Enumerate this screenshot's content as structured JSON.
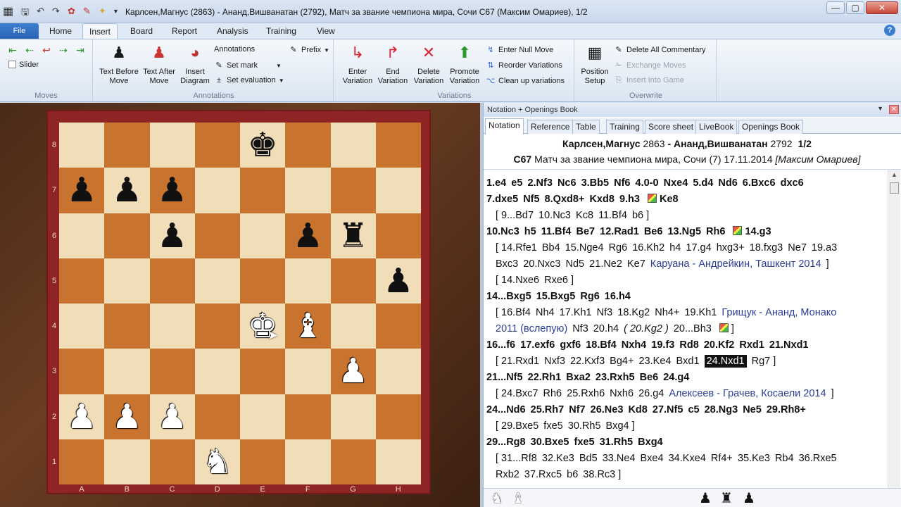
{
  "titlebar": {
    "title": "Карлсен,Магнус (2863) - Ананд,Вишванатан (2792), Матч за звание чемпиона мира, Сочи  C67  (Максим Омариев), 1/2",
    "minimize": "—",
    "maximize": "▢",
    "close": "✕"
  },
  "menu": {
    "file": "File",
    "tabs": [
      "Home",
      "Insert",
      "Board",
      "Report",
      "Analysis",
      "Training",
      "View"
    ],
    "active": "Insert"
  },
  "ribbon": {
    "moves": {
      "slider": "Slider",
      "label": "Moves"
    },
    "annotations": {
      "text_before": "Text Before Move",
      "text_after": "Text After Move",
      "insert_diagram": "Insert Diagram",
      "annotations": "Annotations",
      "set_mark": "Set mark",
      "set_evaluation": "Set evaluation",
      "prefix": "Prefix",
      "label": "Annotations"
    },
    "variations": {
      "enter": "Enter Variation",
      "end": "End Variation",
      "delete": "Delete Variation",
      "promote": "Promote Variation",
      "null_move": "Enter Null Move",
      "reorder": "Reorder Variations",
      "clean_up": "Clean up variations",
      "label": "Variations"
    },
    "overwrite": {
      "position_setup": "Position Setup",
      "delete_commentary": "Delete All Commentary",
      "exchange_moves": "Exchange Moves",
      "insert_into_game": "Insert Into Game",
      "label": "Overwrite"
    }
  },
  "board": {
    "ranks": [
      "8",
      "7",
      "6",
      "5",
      "4",
      "3",
      "2",
      "1"
    ],
    "files": [
      "A",
      "B",
      "C",
      "D",
      "E",
      "F",
      "G",
      "H"
    ],
    "position": [
      [
        "",
        "",
        "",
        "",
        "bk",
        "",
        "",
        ""
      ],
      [
        "bp",
        "bp",
        "bp",
        "",
        "",
        "",
        "",
        ""
      ],
      [
        "",
        "",
        "bp",
        "",
        "",
        "bp",
        "br",
        ""
      ],
      [
        "",
        "",
        "",
        "",
        "",
        "",
        "",
        "bp"
      ],
      [
        "",
        "",
        "",
        "",
        "wk",
        "wb",
        "",
        ""
      ],
      [
        "",
        "",
        "",
        "",
        "",
        "",
        "wp",
        ""
      ],
      [
        "wp",
        "wp",
        "wp",
        "",
        "",
        "",
        "",
        ""
      ],
      [
        "",
        "",
        "",
        "wn",
        "",
        "",
        "",
        ""
      ]
    ]
  },
  "panel": {
    "title": "Notation + Openings Book",
    "tabs": [
      "Notation",
      "Reference",
      "Table",
      "Training",
      "Score sheet",
      "LiveBook",
      "Openings Book"
    ],
    "active_tab": "Notation",
    "white": "Карлсен,Магнус",
    "white_elo": "2863",
    "black": "Ананд,Вишванатан",
    "black_elo": "2792",
    "result": "1/2",
    "eco": "C67",
    "event": "Матч за звание чемпиона мира, Сочи (7) 17.11.2014",
    "annotator": "[Максим Омариев]"
  },
  "notation": [
    {
      "type": "main",
      "parts": [
        {
          "t": "1.e4"
        },
        {
          "t": "e5"
        },
        {
          "t": "2.Nf3"
        },
        {
          "t": "Nc6"
        },
        {
          "t": "3.Bb5"
        },
        {
          "t": "Nf6"
        },
        {
          "t": "4.0-0"
        },
        {
          "t": "Nxe4"
        },
        {
          "t": "5.d4"
        },
        {
          "t": "Nd6"
        },
        {
          "t": "6.Bxc6"
        },
        {
          "t": "dxc6"
        }
      ]
    },
    {
      "type": "main",
      "parts": [
        {
          "t": "7.dxe5"
        },
        {
          "t": "Nf5"
        },
        {
          "t": "8.Qxd8+"
        },
        {
          "t": "Kxd8"
        },
        {
          "t": "9.h3"
        },
        {
          "flag": true
        },
        {
          "t": "Ke8"
        }
      ]
    },
    {
      "type": "var",
      "parts": [
        {
          "t": "[ 9...Bd7"
        },
        {
          "t": "10.Nc3"
        },
        {
          "t": "Kc8"
        },
        {
          "t": "11.Bf4"
        },
        {
          "t": "b6 ]"
        }
      ]
    },
    {
      "type": "main",
      "parts": [
        {
          "t": "10.Nc3"
        },
        {
          "t": "h5"
        },
        {
          "t": "11.Bf4"
        },
        {
          "t": "Be7"
        },
        {
          "t": "12.Rad1"
        },
        {
          "t": "Be6"
        },
        {
          "t": "13.Ng5"
        },
        {
          "t": "Rh6"
        },
        {
          "flag": true
        },
        {
          "t": "14.g3"
        }
      ]
    },
    {
      "type": "var",
      "parts": [
        {
          "t": "[ 14.Rfe1"
        },
        {
          "t": "Bb4"
        },
        {
          "t": "15.Nge4"
        },
        {
          "t": "Rg6"
        },
        {
          "t": "16.Kh2"
        },
        {
          "t": "h4"
        },
        {
          "t": "17.g4"
        },
        {
          "t": "hxg3+"
        },
        {
          "t": "18.fxg3"
        },
        {
          "t": "Ne7"
        },
        {
          "t": "19.a3"
        }
      ]
    },
    {
      "type": "var",
      "parts": [
        {
          "t": "Bxc3"
        },
        {
          "t": "20.Nxc3"
        },
        {
          "t": "Nd5"
        },
        {
          "t": "21.Ne2"
        },
        {
          "t": "Ke7"
        },
        {
          "t": "Каруана - Андрейкин, Ташкент 2014",
          "ref": true
        },
        {
          "t": "]"
        }
      ]
    },
    {
      "type": "var",
      "parts": [
        {
          "t": "[ 14.Nxe6"
        },
        {
          "t": "Rxe6 ]"
        }
      ]
    },
    {
      "type": "main",
      "parts": [
        {
          "t": "14...Bxg5"
        },
        {
          "t": "15.Bxg5"
        },
        {
          "t": "Rg6"
        },
        {
          "t": "16.h4"
        }
      ]
    },
    {
      "type": "var",
      "parts": [
        {
          "t": "[ 16.Bf4"
        },
        {
          "t": "Nh4"
        },
        {
          "t": "17.Kh1"
        },
        {
          "t": "Nf3"
        },
        {
          "t": "18.Kg2"
        },
        {
          "t": "Nh4+"
        },
        {
          "t": "19.Kh1"
        },
        {
          "t": "Грищук - Ананд, Монако",
          "ref": true
        }
      ]
    },
    {
      "type": "var",
      "parts": [
        {
          "t": "2011 (вслепую)",
          "ref": true
        },
        {
          "t": "Nf3"
        },
        {
          "t": "20.h4"
        },
        {
          "t": "( 20.Kg2 )",
          "ital": true
        },
        {
          "t": "20...Bh3"
        },
        {
          "flag": true
        },
        {
          "t": "]"
        }
      ]
    },
    {
      "type": "main",
      "parts": [
        {
          "t": "16...f6"
        },
        {
          "t": "17.exf6"
        },
        {
          "t": "gxf6"
        },
        {
          "t": "18.Bf4"
        },
        {
          "t": "Nxh4"
        },
        {
          "t": "19.f3"
        },
        {
          "t": "Rd8"
        },
        {
          "t": "20.Kf2"
        },
        {
          "t": "Rxd1"
        },
        {
          "t": "21.Nxd1"
        }
      ]
    },
    {
      "type": "var",
      "parts": [
        {
          "t": "[ 21.Rxd1"
        },
        {
          "t": "Nxf3"
        },
        {
          "t": "22.Kxf3"
        },
        {
          "t": "Bg4+"
        },
        {
          "t": "23.Ke4"
        },
        {
          "t": "Bxd1"
        },
        {
          "t": "24.Nxd1",
          "cur": true
        },
        {
          "t": "Rg7 ]"
        }
      ]
    },
    {
      "type": "main",
      "parts": [
        {
          "t": "21...Nf5"
        },
        {
          "t": "22.Rh1"
        },
        {
          "t": "Bxa2"
        },
        {
          "t": "23.Rxh5"
        },
        {
          "t": "Be6"
        },
        {
          "t": "24.g4"
        }
      ]
    },
    {
      "type": "var",
      "parts": [
        {
          "t": "[ 24.Bxc7"
        },
        {
          "t": "Rh6"
        },
        {
          "t": "25.Rxh6"
        },
        {
          "t": "Nxh6"
        },
        {
          "t": "26.g4"
        },
        {
          "t": "Алексеев - Грачев, Косаели 2014",
          "ref": true
        },
        {
          "t": "]"
        }
      ]
    },
    {
      "type": "main",
      "parts": [
        {
          "t": "24...Nd6"
        },
        {
          "t": "25.Rh7"
        },
        {
          "t": "Nf7"
        },
        {
          "t": "26.Ne3"
        },
        {
          "t": "Kd8"
        },
        {
          "t": "27.Nf5"
        },
        {
          "t": "c5"
        },
        {
          "t": "28.Ng3"
        },
        {
          "t": "Ne5"
        },
        {
          "t": "29.Rh8+"
        }
      ]
    },
    {
      "type": "var",
      "parts": [
        {
          "t": "[ 29.Bxe5"
        },
        {
          "t": "fxe5"
        },
        {
          "t": "30.Rh5"
        },
        {
          "t": "Bxg4 ]"
        }
      ]
    },
    {
      "type": "main",
      "parts": [
        {
          "t": "29...Rg8"
        },
        {
          "t": "30.Bxe5"
        },
        {
          "t": "fxe5"
        },
        {
          "t": "31.Rh5"
        },
        {
          "t": "Bxg4"
        }
      ]
    },
    {
      "type": "var",
      "parts": [
        {
          "t": "[ 31...Rf8"
        },
        {
          "t": "32.Ke3"
        },
        {
          "t": "Bd5"
        },
        {
          "t": "33.Ne4"
        },
        {
          "t": "Bxe4"
        },
        {
          "t": "34.Kxe4"
        },
        {
          "t": "Rf4+"
        },
        {
          "t": "35.Ke3"
        },
        {
          "t": "Rb4"
        },
        {
          "t": "36.Rxe5"
        }
      ]
    },
    {
      "type": "var",
      "parts": [
        {
          "t": "Rxb2"
        },
        {
          "t": "37.Rxc5"
        },
        {
          "t": "b6"
        },
        {
          "t": "38.Rc3 ]"
        }
      ]
    }
  ]
}
